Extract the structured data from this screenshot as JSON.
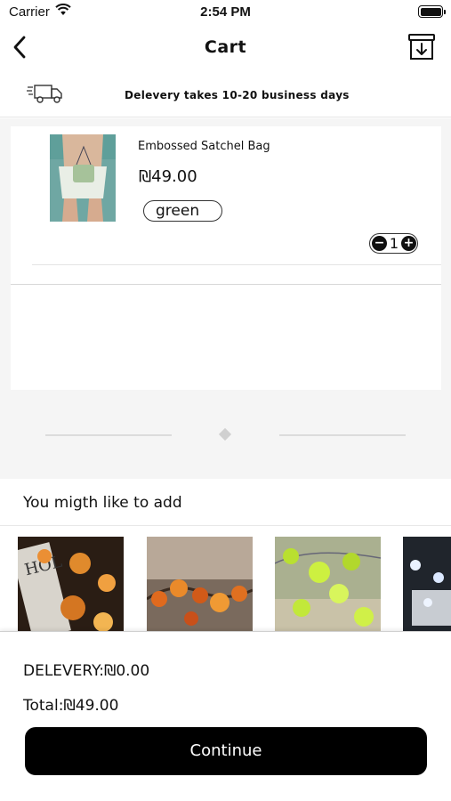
{
  "status_bar": {
    "carrier": "Carrier",
    "time": "2:54 PM"
  },
  "nav": {
    "title": "Cart"
  },
  "delivery_notice": {
    "text": "Delevery takes 10-20 business days"
  },
  "cart": {
    "items": [
      {
        "name": "Embossed Satchel Bag",
        "price": "₪49.00",
        "variant": "green",
        "quantity": "1"
      }
    ]
  },
  "suggestions": {
    "title": "You migth like to add",
    "items": [
      {
        "image": "leaf-lights-newspaper-photo"
      },
      {
        "image": "autumn-leaf-string-lights-photo"
      },
      {
        "image": "green-leaf-lights-photo"
      },
      {
        "image": "blue-lights-display-photo"
      }
    ]
  },
  "summary": {
    "delivery": "DELEVERY:₪0.00",
    "total": "Total:₪49.00",
    "continue_label": "Continue"
  },
  "colors": {
    "primary_button": "#000000",
    "background": "#f5f5f5"
  }
}
